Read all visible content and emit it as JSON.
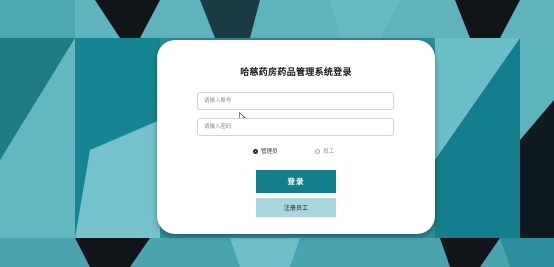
{
  "page": {
    "title": "哈慈药房药品管理系统登录"
  },
  "form": {
    "username_placeholder": "请输入账号",
    "password_placeholder": "请输入密码",
    "username_value": "",
    "password_value": ""
  },
  "roles": {
    "admin_label": "管理员",
    "staff_label": "员工",
    "selected": "管理员"
  },
  "buttons": {
    "login_label": "登录",
    "register_label": "注册员工"
  },
  "colors": {
    "primary": "#127f8a",
    "secondary": "#a9d6dd",
    "background": "#2a7f8e",
    "card": "#ffffff"
  },
  "icons": {
    "cursor": "mouse-pointer-icon"
  }
}
